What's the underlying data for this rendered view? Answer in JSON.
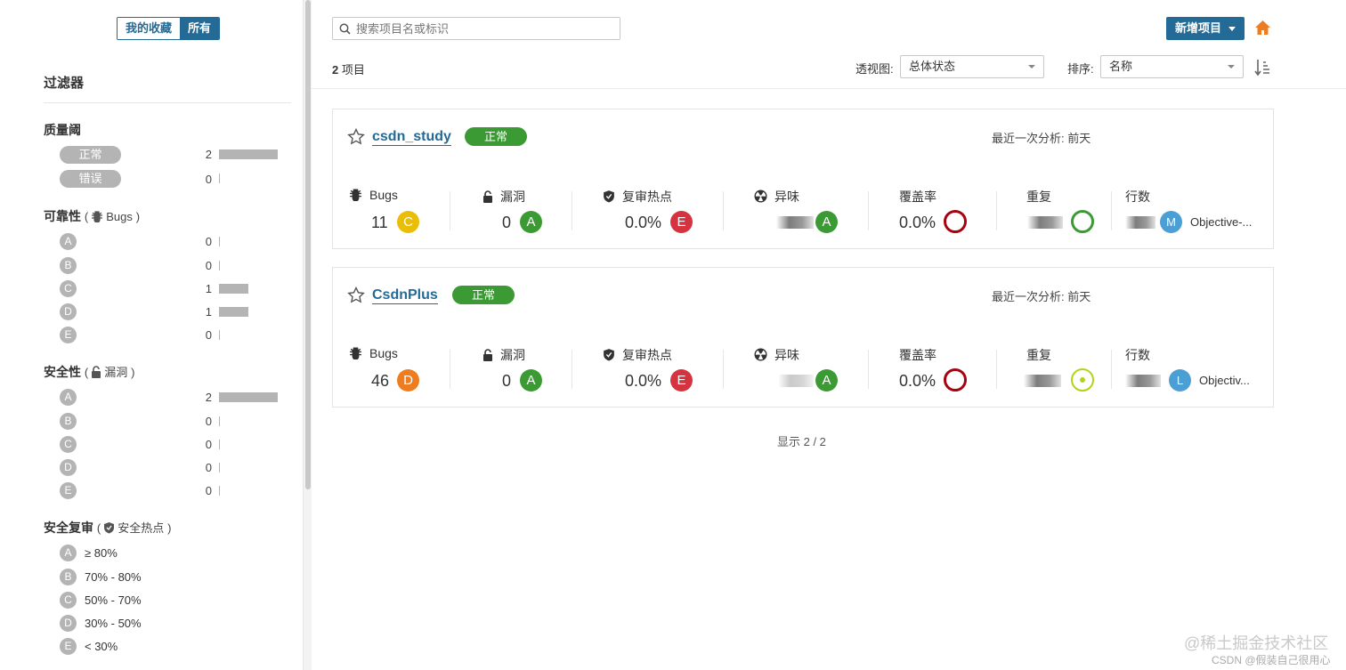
{
  "sidebar": {
    "toggle": {
      "favorites": "我的收藏",
      "all": "所有"
    },
    "filter_title": "过滤器",
    "quality_gate": {
      "title": "质量阈",
      "items": [
        {
          "label": "正常",
          "count": "2"
        },
        {
          "label": "错误",
          "count": "0"
        }
      ]
    },
    "reliability": {
      "title": "可靠性",
      "open": "(",
      "sub": "Bugs",
      "close": ")",
      "items": [
        {
          "label": "A",
          "count": "0"
        },
        {
          "label": "B",
          "count": "0"
        },
        {
          "label": "C",
          "count": "1"
        },
        {
          "label": "D",
          "count": "1"
        },
        {
          "label": "E",
          "count": "0"
        }
      ]
    },
    "security": {
      "title": "安全性",
      "open": "(",
      "sub": "漏洞",
      "close": ")",
      "items": [
        {
          "label": "A",
          "count": "2"
        },
        {
          "label": "B",
          "count": "0"
        },
        {
          "label": "C",
          "count": "0"
        },
        {
          "label": "D",
          "count": "0"
        },
        {
          "label": "E",
          "count": "0"
        }
      ]
    },
    "security_review": {
      "title": "安全复审",
      "open": "(",
      "sub": "安全热点",
      "close": ")",
      "items": [
        {
          "label": "A",
          "range": "≥ 80%"
        },
        {
          "label": "B",
          "range": "70% - 80%"
        },
        {
          "label": "C",
          "range": "50% - 70%"
        },
        {
          "label": "D",
          "range": "30% - 50%"
        },
        {
          "label": "E",
          "range": "< 30%"
        }
      ]
    }
  },
  "header": {
    "search_placeholder": "搜索项目名或标识",
    "new_project": "新增项目",
    "count_number": "2",
    "count_label": "项目",
    "perspective_label": "透视图:",
    "perspective_value": "总体状态",
    "sort_label": "排序:",
    "sort_value": "名称"
  },
  "projects": [
    {
      "name": "csdn_study",
      "gate": "正常",
      "last_analysis": "最近一次分析:  前天",
      "metrics": {
        "bugs_label": "Bugs",
        "bugs_value": "11",
        "bugs_rating": "C",
        "vuln_label": "漏洞",
        "vuln_value": "0",
        "vuln_rating": "A",
        "hotspots_label": "复审热点",
        "hotspots_value": "0.0%",
        "hotspots_rating": "E",
        "smells_label": "异味",
        "smells_rating": "A",
        "coverage_label": "覆盖率",
        "coverage_value": "0.0%",
        "dup_label": "重复",
        "lines_label": "行数",
        "lang_initial": "M",
        "lang_text": "Objective-..."
      }
    },
    {
      "name": "CsdnPlus",
      "gate": "正常",
      "last_analysis": "最近一次分析:  前天",
      "metrics": {
        "bugs_label": "Bugs",
        "bugs_value": "46",
        "bugs_rating": "D",
        "vuln_label": "漏洞",
        "vuln_value": "0",
        "vuln_rating": "A",
        "hotspots_label": "复审热点",
        "hotspots_value": "0.0%",
        "hotspots_rating": "E",
        "smells_label": "异味",
        "smells_rating": "A",
        "coverage_label": "覆盖率",
        "coverage_value": "0.0%",
        "dup_label": "重复",
        "lines_label": "行数",
        "lang_initial": "L",
        "lang_text": "Objectiv..."
      }
    }
  ],
  "footer": {
    "shown": "显示 2 / 2"
  },
  "watermark": {
    "line1": "@稀土掘金技术社区",
    "line2": "CSDN @假装自己很用心"
  },
  "colors": {
    "primary": "#236a97",
    "ok": "#3c9a34",
    "rating_a": "#3c9a34",
    "rating_c": "#eabe06",
    "rating_d": "#ed7d20",
    "rating_e": "#d4333f",
    "coverage_ring": "#a4030f",
    "dup_ring_1": "#3c9a34",
    "dup_ring_2": "#b0d513",
    "home": "#ed7d20"
  }
}
